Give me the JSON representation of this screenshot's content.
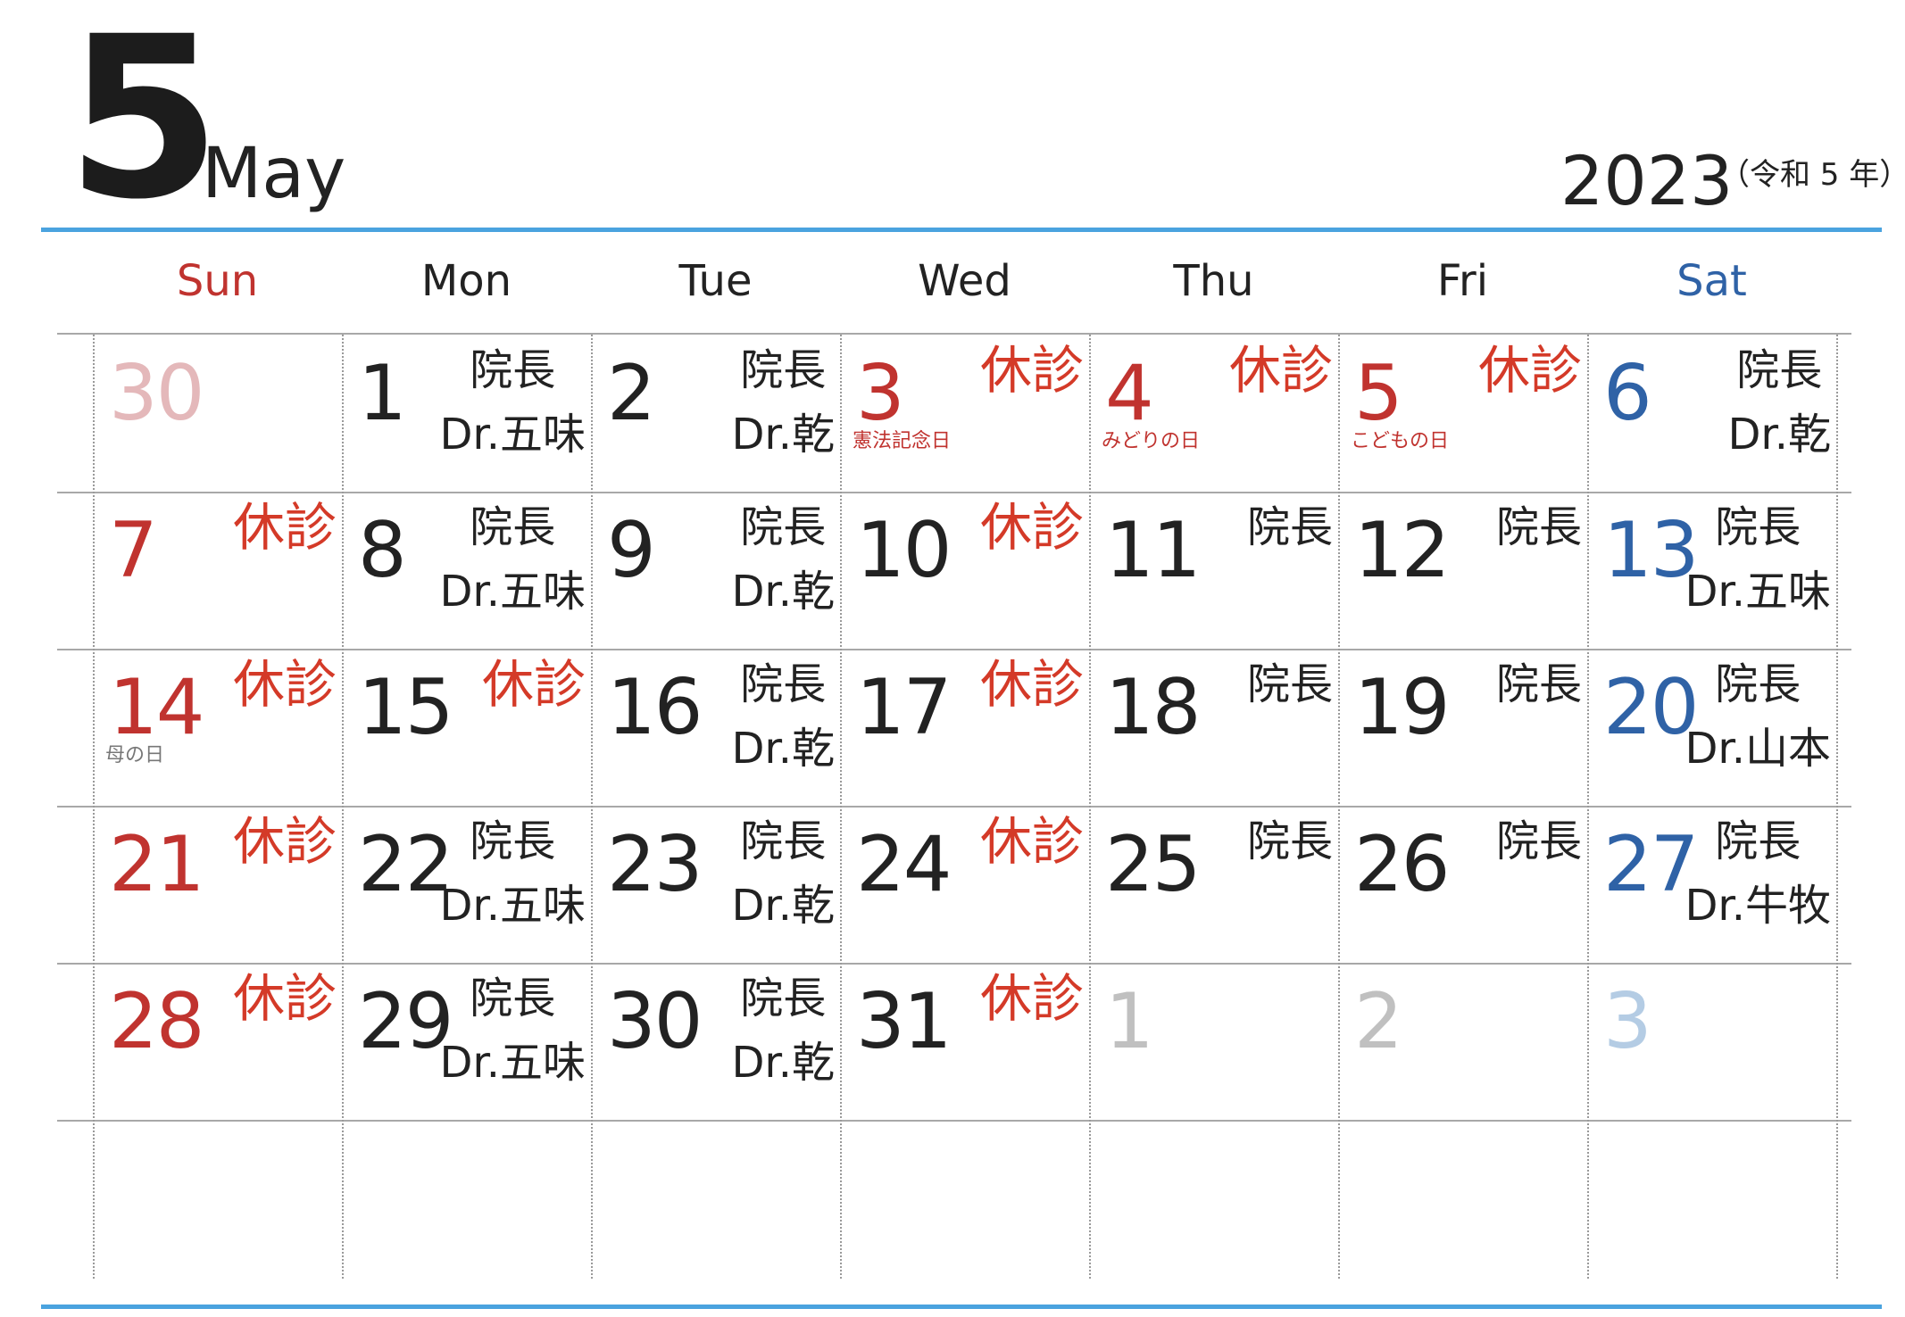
{
  "header": {
    "month_number": "5",
    "month_name": "May",
    "year": "2023",
    "era": "（令和 5 年）"
  },
  "weekdays": [
    {
      "label": "Sun",
      "color": "#c0332f"
    },
    {
      "label": "Mon",
      "color": "#222222"
    },
    {
      "label": "Tue",
      "color": "#222222"
    },
    {
      "label": "Wed",
      "color": "#222222"
    },
    {
      "label": "Thu",
      "color": "#222222"
    },
    {
      "label": "Fri",
      "color": "#222222"
    },
    {
      "label": "Sat",
      "color": "#2f62a6"
    }
  ],
  "colors": {
    "accent_line": "#4aa3df",
    "closed": "#d43a28",
    "sunday_holiday": "#c0332f",
    "saturday": "#2f62a6"
  },
  "weeks": [
    [
      {
        "day": "30",
        "style": "pink",
        "tag": ""
      },
      {
        "day": "1",
        "style": "normal",
        "tag": "doc",
        "tag_title": "院長",
        "tag_doctor": "Dr.五味"
      },
      {
        "day": "2",
        "style": "normal",
        "tag": "doc",
        "tag_title": "院長",
        "tag_doctor": "Dr.乾"
      },
      {
        "day": "3",
        "style": "red",
        "tag": "closed",
        "tag_text": "休診",
        "holiday": "憲法記念日",
        "holiday_style": "red"
      },
      {
        "day": "4",
        "style": "red",
        "tag": "closed",
        "tag_text": "休診",
        "holiday": "みどりの日",
        "holiday_style": "red"
      },
      {
        "day": "5",
        "style": "red",
        "tag": "closed",
        "tag_text": "休診",
        "holiday": "こどもの日",
        "holiday_style": "red"
      },
      {
        "day": "6",
        "style": "blue",
        "tag": "doc",
        "tag_title": "院長",
        "tag_doctor": "Dr.乾"
      }
    ],
    [
      {
        "day": "7",
        "style": "red",
        "tag": "closed",
        "tag_text": "休診"
      },
      {
        "day": "8",
        "style": "normal",
        "tag": "doc",
        "tag_title": "院長",
        "tag_doctor": "Dr.五味"
      },
      {
        "day": "9",
        "style": "normal",
        "tag": "doc",
        "tag_title": "院長",
        "tag_doctor": "Dr.乾"
      },
      {
        "day": "10",
        "style": "normal",
        "tag": "closed",
        "tag_text": "休診"
      },
      {
        "day": "11",
        "style": "normal",
        "tag": "doc",
        "tag_title": "院長",
        "tag_doctor": ""
      },
      {
        "day": "12",
        "style": "normal",
        "tag": "doc",
        "tag_title": "院長",
        "tag_doctor": ""
      },
      {
        "day": "13",
        "style": "blue",
        "tag": "doc",
        "tag_title": "院長",
        "tag_doctor": "Dr.五味"
      }
    ],
    [
      {
        "day": "14",
        "style": "red",
        "tag": "closed",
        "tag_text": "休診",
        "holiday": "母の日",
        "holiday_style": "gray"
      },
      {
        "day": "15",
        "style": "normal",
        "tag": "closed",
        "tag_text": "休診"
      },
      {
        "day": "16",
        "style": "normal",
        "tag": "doc",
        "tag_title": "院長",
        "tag_doctor": "Dr.乾"
      },
      {
        "day": "17",
        "style": "normal",
        "tag": "closed",
        "tag_text": "休診"
      },
      {
        "day": "18",
        "style": "normal",
        "tag": "doc",
        "tag_title": "院長",
        "tag_doctor": ""
      },
      {
        "day": "19",
        "style": "normal",
        "tag": "doc",
        "tag_title": "院長",
        "tag_doctor": ""
      },
      {
        "day": "20",
        "style": "blue",
        "tag": "doc",
        "tag_title": "院長",
        "tag_doctor": "Dr.山本"
      }
    ],
    [
      {
        "day": "21",
        "style": "red",
        "tag": "closed",
        "tag_text": "休診"
      },
      {
        "day": "22",
        "style": "normal",
        "tag": "doc",
        "tag_title": "院長",
        "tag_doctor": "Dr.五味"
      },
      {
        "day": "23",
        "style": "normal",
        "tag": "doc",
        "tag_title": "院長",
        "tag_doctor": "Dr.乾"
      },
      {
        "day": "24",
        "style": "normal",
        "tag": "closed",
        "tag_text": "休診"
      },
      {
        "day": "25",
        "style": "normal",
        "tag": "doc",
        "tag_title": "院長",
        "tag_doctor": ""
      },
      {
        "day": "26",
        "style": "normal",
        "tag": "doc",
        "tag_title": "院長",
        "tag_doctor": ""
      },
      {
        "day": "27",
        "style": "blue",
        "tag": "doc",
        "tag_title": "院長",
        "tag_doctor": "Dr.牛牧"
      }
    ],
    [
      {
        "day": "28",
        "style": "red",
        "tag": "closed",
        "tag_text": "休診"
      },
      {
        "day": "29",
        "style": "normal",
        "tag": "doc",
        "tag_title": "院長",
        "tag_doctor": "Dr.五味"
      },
      {
        "day": "30",
        "style": "normal",
        "tag": "doc",
        "tag_title": "院長",
        "tag_doctor": "Dr.乾"
      },
      {
        "day": "31",
        "style": "normal",
        "tag": "closed",
        "tag_text": "休診"
      },
      {
        "day": "1",
        "style": "gray",
        "tag": ""
      },
      {
        "day": "2",
        "style": "gray",
        "tag": ""
      },
      {
        "day": "3",
        "style": "lightblue",
        "tag": ""
      }
    ],
    [
      {
        "day": "",
        "style": "normal",
        "tag": ""
      },
      {
        "day": "",
        "style": "normal",
        "tag": ""
      },
      {
        "day": "",
        "style": "normal",
        "tag": ""
      },
      {
        "day": "",
        "style": "normal",
        "tag": ""
      },
      {
        "day": "",
        "style": "normal",
        "tag": ""
      },
      {
        "day": "",
        "style": "normal",
        "tag": ""
      },
      {
        "day": "",
        "style": "normal",
        "tag": ""
      }
    ]
  ]
}
